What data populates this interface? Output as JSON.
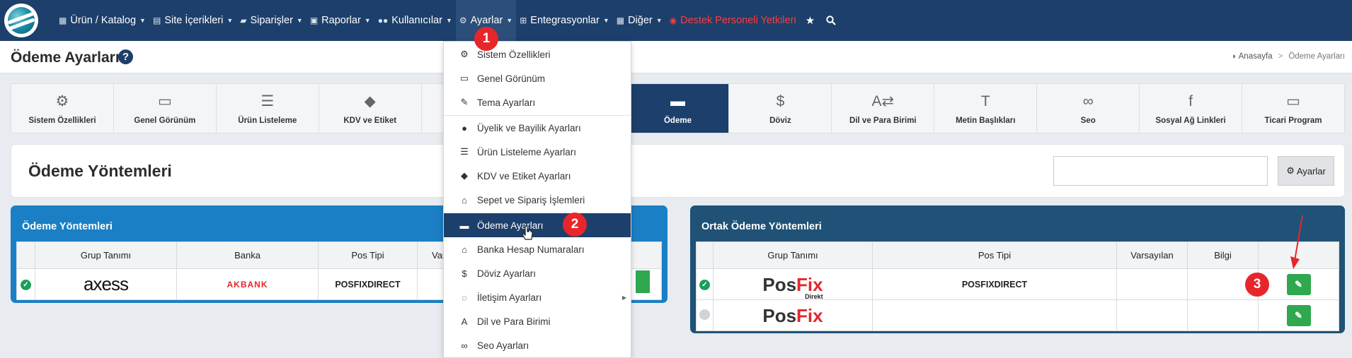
{
  "nav": {
    "items": [
      {
        "icon": "boxes-icon",
        "label": "Ürün / Katalog"
      },
      {
        "icon": "document-icon",
        "label": "Site İçerikleri"
      },
      {
        "icon": "truck-icon",
        "label": "Siparişler"
      },
      {
        "icon": "report-icon",
        "label": "Raporlar"
      },
      {
        "icon": "users-icon",
        "label": "Kullanıcılar"
      },
      {
        "icon": "gears-icon",
        "label": "Ayarlar"
      },
      {
        "icon": "sitemap-icon",
        "label": "Entegrasyonlar"
      },
      {
        "icon": "grid-icon",
        "label": "Diğer"
      }
    ],
    "support_label": "Destek Personeli Yetkileri"
  },
  "header": {
    "page_title": "Ödeme Ayarları",
    "help_glyph": "?",
    "breadcrumb": {
      "home": "Anasayfa",
      "separator": ">",
      "current": "Ödeme Ayarları"
    }
  },
  "tabs": [
    {
      "icon": "gears-icon",
      "label": "Sistem Özellikleri"
    },
    {
      "icon": "monitor-icon",
      "label": "Genel Görünüm"
    },
    {
      "icon": "list-icon",
      "label": "Ürün Listeleme"
    },
    {
      "icon": "tags-icon",
      "label": "KDV ve Etiket"
    },
    {
      "icon": "basket-icon",
      "label": ""
    },
    {
      "icon": "card-icon",
      "label": ""
    },
    {
      "icon": "card-icon",
      "label": "Ödeme"
    },
    {
      "icon": "dollar-icon",
      "label": "Döviz"
    },
    {
      "icon": "language-icon",
      "label": "Dil ve Para Birimi"
    },
    {
      "icon": "text-height-icon",
      "label": "Metin Başlıkları"
    },
    {
      "icon": "link-icon",
      "label": "Seo"
    },
    {
      "icon": "facebook-icon",
      "label": "Sosyal Ağ Linkleri"
    },
    {
      "icon": "program-icon",
      "label": "Ticari Program"
    }
  ],
  "main": {
    "title": "Ödeme Yöntemleri",
    "search_value": "",
    "settings_button": "Ayarlar"
  },
  "left_table": {
    "title": "Ödeme Yöntemleri",
    "columns": [
      "",
      "Grup Tanımı",
      "Banka",
      "Pos Tipi",
      "Var"
    ],
    "rows": [
      {
        "status": "active",
        "group": "axess",
        "bank": "AKBANK",
        "pos_type": "POSFIXDIRECT"
      }
    ]
  },
  "right_table": {
    "title": "Ortak Ödeme Yöntemleri",
    "columns": [
      "",
      "Grup Tanımı",
      "Pos Tipi",
      "Varsayılan",
      "Bilgi",
      ""
    ],
    "rows": [
      {
        "status": "active",
        "group_logo": {
          "pos": "Pos",
          "fix": "Fix",
          "sub": "Direkt"
        },
        "pos_type": "POSFIXDIRECT"
      },
      {
        "status": "inactive",
        "group_logo": {
          "pos": "Pos",
          "fix": "Fix",
          "sub": ""
        },
        "pos_type": ""
      }
    ]
  },
  "dropdown": {
    "items": [
      {
        "icon": "gears-icon",
        "label": "Sistem Özellikleri"
      },
      {
        "icon": "monitor-icon",
        "label": "Genel Görünüm"
      },
      {
        "icon": "brush-icon",
        "label": "Tema Ayarları"
      },
      {
        "icon": "users-icon",
        "label": "Üyelik ve Bayilik Ayarları"
      },
      {
        "icon": "list-icon",
        "label": "Ürün Listeleme Ayarları"
      },
      {
        "icon": "tags-icon",
        "label": "KDV ve Etiket Ayarları"
      },
      {
        "icon": "basket-icon",
        "label": "Sepet ve Sipariş İşlemleri"
      },
      {
        "icon": "card-icon",
        "label": "Ödeme Ayarları"
      },
      {
        "icon": "bank-icon",
        "label": "Banka Hesap Numaraları"
      },
      {
        "icon": "dollar-icon",
        "label": "Döviz Ayarları"
      },
      {
        "icon": "comments-icon",
        "label": "İletişim Ayarları"
      },
      {
        "icon": "language-icon",
        "label": "Dil ve Para Birimi"
      },
      {
        "icon": "link-icon",
        "label": "Seo Ayarları"
      }
    ]
  },
  "annotations": {
    "badge1": "1",
    "badge2": "2",
    "badge3": "3"
  },
  "colors": {
    "nav_bg": "#1d3f6b",
    "accent_blue": "#1a7fc4",
    "dark_card": "#1f5276",
    "success": "#2fa84f",
    "danger": "#e7262b",
    "support_red": "#ff3b3b"
  }
}
